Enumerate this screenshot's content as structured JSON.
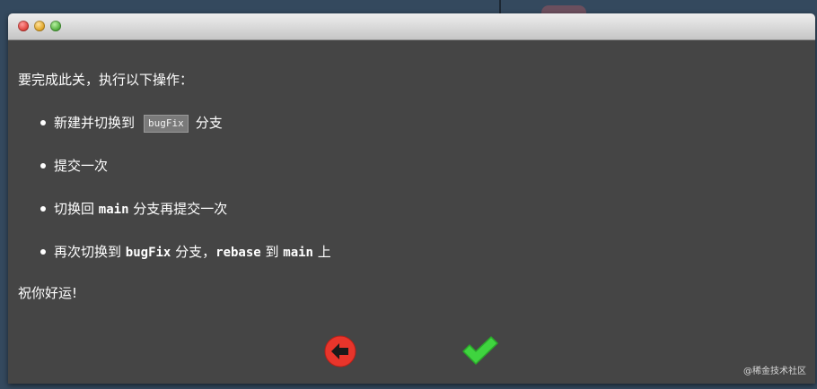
{
  "window": {
    "title": ""
  },
  "dialog": {
    "intro": "要完成此关，执行以下操作：",
    "tasks": [
      {
        "before": "新建并切换到",
        "code": "bugFix",
        "after": "分支"
      },
      {
        "text": "提交一次"
      },
      {
        "before": "切换回 ",
        "code": "main",
        "after": " 分支再提交一次"
      },
      {
        "before": "再次切换到 ",
        "code": "bugFix",
        "middle": " 分支，",
        "code2": "rebase",
        "middle2": " 到 ",
        "code3": "main",
        "after": " 上"
      }
    ],
    "outro": "祝你好运!"
  },
  "buttons": {
    "back_icon": "back-arrow-icon",
    "confirm_icon": "checkmark-icon",
    "back_color": "#e8352b",
    "confirm_color": "#3fd43f"
  },
  "watermark": "@稀金技术社区"
}
